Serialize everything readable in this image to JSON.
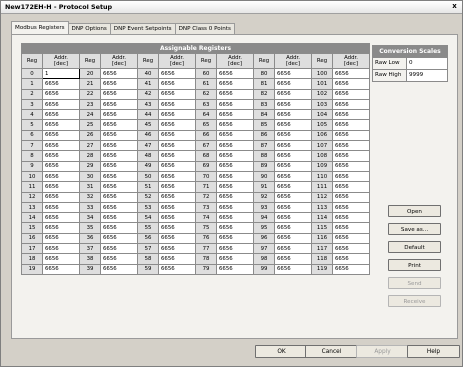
{
  "window": {
    "title": "New172EH-H - Protocol Setup",
    "close": "x"
  },
  "tabs": [
    "Modbus Registers",
    "DNP Options",
    "DNP Event Setpoints",
    "DNP Class 0 Points"
  ],
  "table": {
    "caption": "Assignable Registers",
    "col_reg": "Reg",
    "col_addr": "Addr.\n[dec]",
    "column_groups": 6,
    "rows_per_group": 20,
    "default_addr": "6656",
    "first_addr": "1"
  },
  "conversion": {
    "title": "Conversion Scales",
    "raw_low_label": "Raw Low",
    "raw_low_value": "0",
    "raw_high_label": "Raw High",
    "raw_high_value": "9999"
  },
  "side_buttons": {
    "open": "Open",
    "save_as": "Save as...",
    "default": "Default",
    "print": "Print",
    "send": "Send",
    "receive": "Receive"
  },
  "bottom_buttons": {
    "ok": "OK",
    "cancel": "Cancel",
    "apply": "Apply",
    "help": "Help"
  }
}
